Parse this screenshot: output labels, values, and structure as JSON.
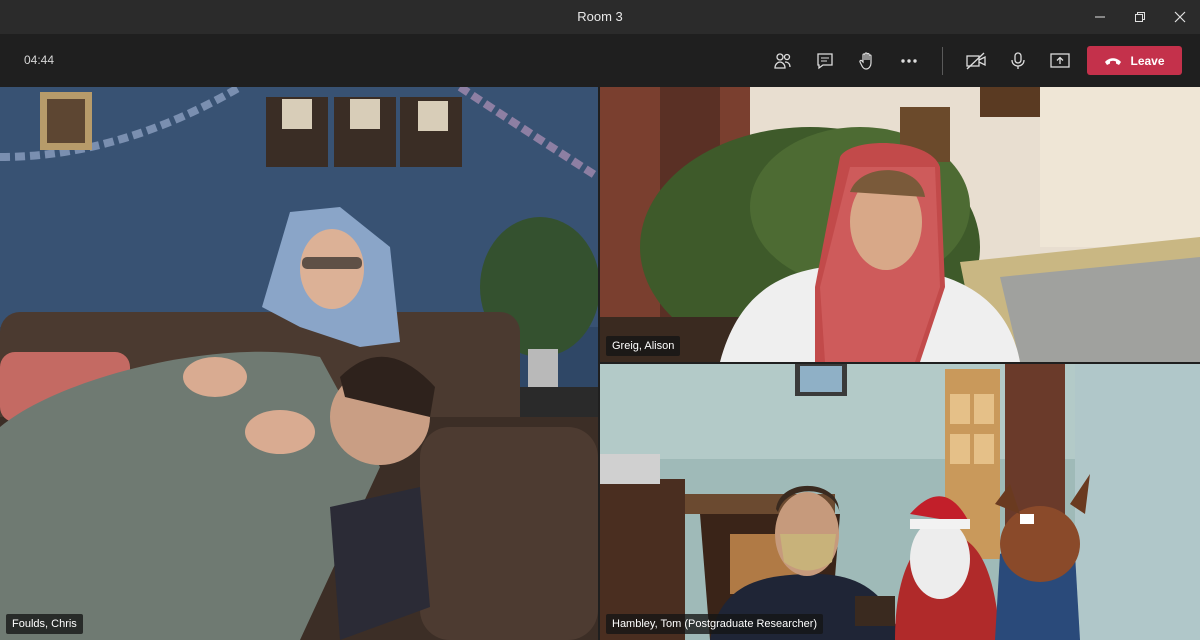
{
  "window": {
    "title": "Room 3"
  },
  "toolbar": {
    "timer": "04:44",
    "leave_label": "Leave",
    "icons": [
      "participants-icon",
      "chat-icon",
      "raise-hand-icon",
      "more-options-icon",
      "camera-off-icon",
      "microphone-icon",
      "share-screen-icon"
    ]
  },
  "participants": [
    {
      "name": "Foulds, Chris"
    },
    {
      "name": "Greig, Alison"
    },
    {
      "name": "Hambley, Tom (Postgraduate Researcher)"
    }
  ],
  "colors": {
    "leave": "#c4314b",
    "titlebar": "#2b2b2b",
    "toolbar": "#1f1f1f"
  }
}
